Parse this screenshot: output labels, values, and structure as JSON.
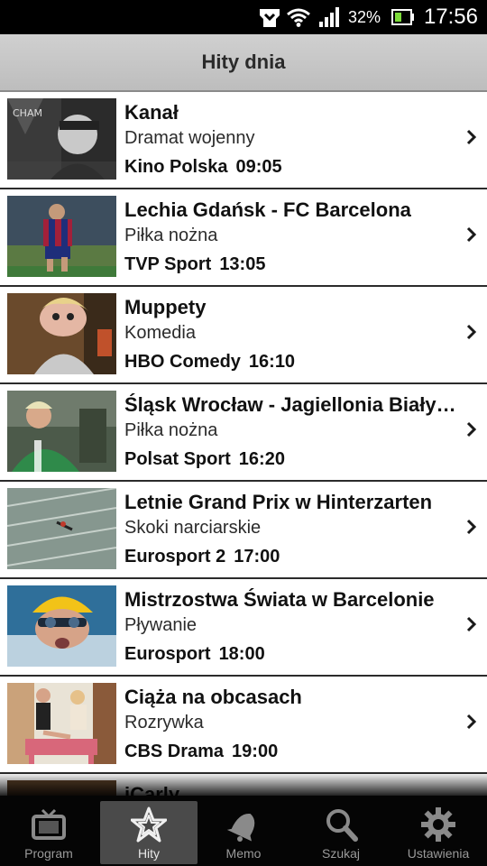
{
  "status_bar": {
    "battery_percent": "32%",
    "time": "17:56"
  },
  "header": {
    "title": "Hity dnia"
  },
  "list": {
    "items": [
      {
        "title": "Kanał",
        "genre": "Dramat wojenny",
        "channel": "Kino Polska",
        "time": "09:05"
      },
      {
        "title": "Lechia Gdańsk - FC Barcelona",
        "genre": "Piłka nożna",
        "channel": "TVP Sport",
        "time": "13:05"
      },
      {
        "title": "Muppety",
        "genre": "Komedia",
        "channel": "HBO Comedy",
        "time": "16:10"
      },
      {
        "title": "Śląsk Wrocław - Jagiellonia Białystok",
        "genre": "Piłka nożna",
        "channel": "Polsat Sport",
        "time": "16:20"
      },
      {
        "title": "Letnie Grand Prix w Hinterzarten",
        "genre": "Skoki narciarskie",
        "channel": "Eurosport 2",
        "time": "17:00"
      },
      {
        "title": "Mistrzostwa Świata w Barcelonie",
        "genre": "Pływanie",
        "channel": "Eurosport",
        "time": "18:00"
      },
      {
        "title": "Ciąża na obcasach",
        "genre": "Rozrywka",
        "channel": "CBS Drama",
        "time": "19:00"
      },
      {
        "title": "iCarly",
        "genre": "",
        "channel": "",
        "time": ""
      }
    ]
  },
  "thumbnail_text": {
    "kanal_graffiti": "CHAM"
  },
  "bottom_nav": {
    "items": [
      {
        "label": "Program",
        "icon": "tv-icon",
        "active": false
      },
      {
        "label": "Hity",
        "icon": "star-icon",
        "active": true
      },
      {
        "label": "Memo",
        "icon": "bell-icon",
        "active": false
      },
      {
        "label": "Szukaj",
        "icon": "search-icon",
        "active": false
      },
      {
        "label": "Ustawienia",
        "icon": "gear-icon",
        "active": false
      }
    ]
  },
  "colors": {
    "header_bg": "#c6c6c6",
    "nav_bg": "#050505",
    "nav_active_bg": "#4a4a4a",
    "divider": "#2b2b2b"
  }
}
